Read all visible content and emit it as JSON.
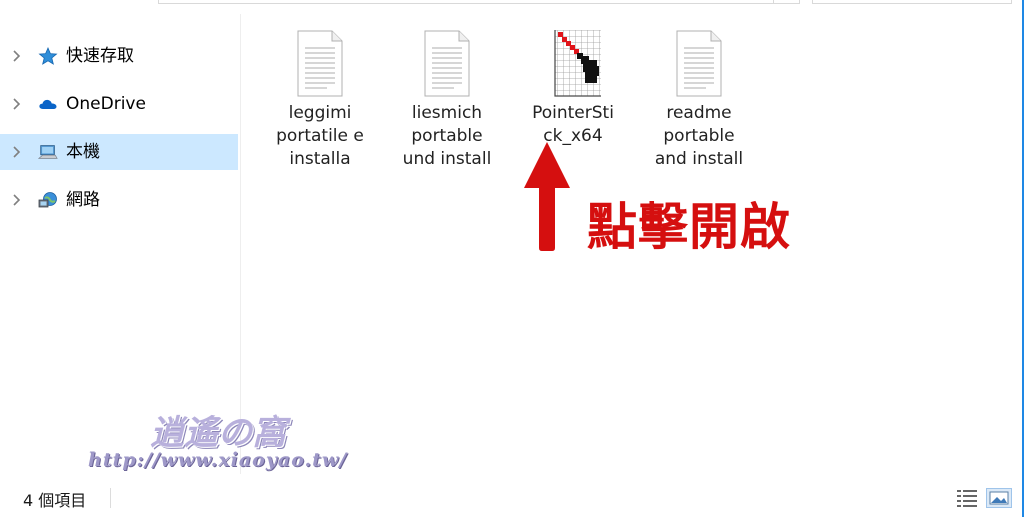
{
  "nav": {
    "items": [
      {
        "label": "快速存取",
        "icon": "star-quick-access-icon",
        "selected": false
      },
      {
        "label": "OneDrive",
        "icon": "cloud-icon",
        "selected": false
      },
      {
        "label": "本機",
        "icon": "computer-icon",
        "selected": true
      },
      {
        "label": "網路",
        "icon": "network-icon",
        "selected": false
      }
    ]
  },
  "files": [
    {
      "line1": "leggimi",
      "line2": "portatile e",
      "line3": "installa",
      "icon": "text-document-icon"
    },
    {
      "line1": "liesmich",
      "line2": "portable",
      "line3": "und install",
      "icon": "text-document-icon"
    },
    {
      "line1": "PointerSti",
      "line2": "ck_x64",
      "line3": "",
      "icon": "pointerstick-app-icon"
    },
    {
      "line1": "readme",
      "line2": "portable",
      "line3": "and install",
      "icon": "text-document-icon"
    }
  ],
  "annotation": {
    "text": "點擊開啟",
    "color": "#d50f0f",
    "icon": "up-arrow-icon"
  },
  "watermark": {
    "logo": "逍遙の窩",
    "url": "http://www.xiaoyao.tw/"
  },
  "status": {
    "item_count": "4 個項目",
    "view_icons": [
      "details-view-icon",
      "large-icons-view-icon"
    ]
  },
  "colors": {
    "selection": "#cce8ff",
    "window_border": "#1e88e5"
  }
}
